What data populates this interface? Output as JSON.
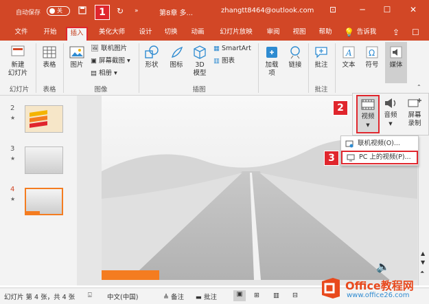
{
  "titlebar": {
    "autosave": "自动保存",
    "toggle": "关",
    "doc_title": "第8章 多...",
    "account": "zhangtt8464@outlook.com",
    "callout1": "1"
  },
  "tabs": [
    "文件",
    "开始",
    "插入",
    "美化大师",
    "设计",
    "切换",
    "动画",
    "幻灯片放映",
    "审阅",
    "视图",
    "帮助"
  ],
  "tell_me": "告诉我",
  "ribbon": {
    "new_slide": "新建\n幻灯片",
    "table": "表格",
    "picture": "图片",
    "online_picture": "联机图片",
    "screenshot": "屏幕截图",
    "album": "相册",
    "shapes": "形状",
    "icons": "图标",
    "model3d": "3D\n模型",
    "smartart": "SmartArt",
    "chart": "图表",
    "addins": "加载\n项",
    "link": "链接",
    "comment": "批注",
    "text": "文本",
    "symbol": "符号",
    "media": "媒体",
    "groups": {
      "slides": "幻灯片",
      "tables": "表格",
      "images": "图像",
      "illustrations": "插图",
      "comments": "批注"
    }
  },
  "media_popup": {
    "video": "视频",
    "audio": "音频",
    "screen_record": "屏幕\n录制",
    "callout2": "2"
  },
  "video_menu": {
    "online": "联机视频(O)...",
    "pc": "PC 上的视频(P)...",
    "callout3": "3"
  },
  "slides": [
    {
      "num": "2",
      "star": "★"
    },
    {
      "num": "3",
      "star": "★"
    },
    {
      "num": "4",
      "star": "★"
    }
  ],
  "statusbar": {
    "slide_info": "幻灯片 第 4 张，共 4 张",
    "language": "中文(中国)",
    "notes": "备注",
    "comments": "批注"
  },
  "watermark": {
    "brand": "Office教程网",
    "url": "www.office26.com"
  },
  "colors": {
    "accent": "#d24726",
    "callout": "#e0262d",
    "orange": "#f47c20"
  }
}
